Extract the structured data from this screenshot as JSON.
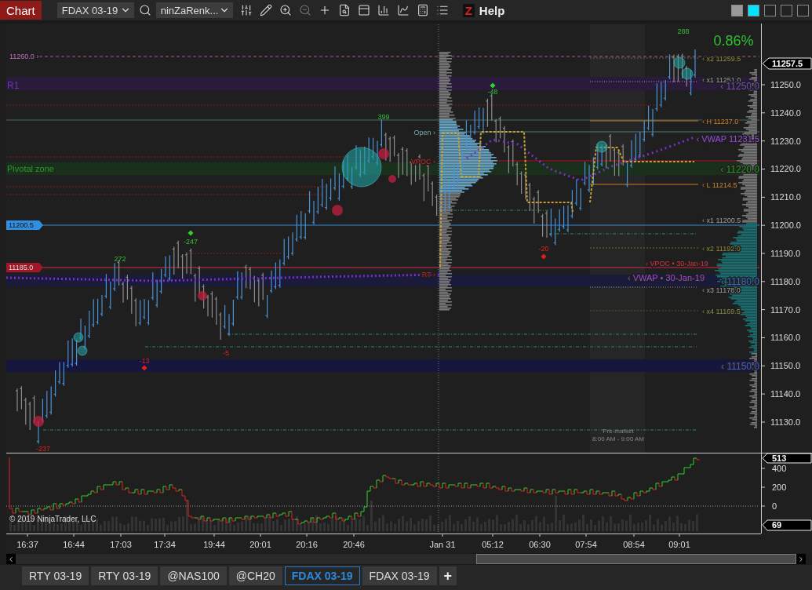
{
  "toolbar": {
    "title": "Chart",
    "instrument": "FDAX 03-19",
    "bar_type": "ninZaRenk...",
    "logo": "Z",
    "help": "Help"
  },
  "price_panel": {
    "change": "0.86%",
    "current_price": "11257.5",
    "y_ticks": [
      "11250.0",
      "11240.0",
      "11230.0",
      "11220.0",
      "11210.0",
      "11200.0",
      "11190.0",
      "11180.0",
      "11170.0",
      "11160.0",
      "11150.0",
      "11140.0",
      "11130.0"
    ],
    "left_tags": [
      {
        "text": "11260.0 ›",
        "kind": "plain"
      },
      {
        "text": "11200.5",
        "kind": "tag"
      },
      {
        "text": "11185.0",
        "kind": "tag"
      }
    ],
    "zone_labels": [
      "R1",
      "Pivotal zone"
    ],
    "level_labels": [
      "‹ x2 11259.5",
      "‹ x1 11251.0",
      "‹ 11250.0",
      "‹ H 11237.0",
      "‹ VWAP 11231.5",
      "‹ 11220.0",
      "‹ L 11214.5",
      "‹ x1 11200.5",
      "‹ x2 11192.0",
      "‹ VPOC • 30-Jan-19",
      "‹ VWAP • 30-Jan-19",
      "‹ 11180.0",
      "‹ x3 11178.0",
      "‹ x4 11169.5",
      "‹ 11150.0"
    ],
    "markers": [
      "Open ›",
      "VPOC ›",
      "RT ›"
    ],
    "annotations": [
      "288",
      "-48",
      "399",
      "-247",
      "272",
      "-20",
      "-5",
      "-13",
      "-237"
    ],
    "session": {
      "title": "Pre-market",
      "hours": "8:00 AM - 9:00 AM"
    }
  },
  "indicator_panel": {
    "y_ticks": [
      "400",
      "200",
      "0"
    ],
    "current_value": "513",
    "low_value": "69",
    "copyright": "© 2019 NinjaTrader, LLC"
  },
  "time_axis": [
    "16:37",
    "16:44",
    "17:03",
    "17:34",
    "19:44",
    "20:01",
    "20:16",
    "20:46",
    "Jan 31",
    "05:12",
    "06:30",
    "07:54",
    "08:54",
    "09:01"
  ],
  "tabs": [
    {
      "label": "RTY 03-19",
      "selected": false
    },
    {
      "label": "RTY 03-19",
      "selected": false
    },
    {
      "label": "@NAS100",
      "selected": false
    },
    {
      "label": "@CH20",
      "selected": false
    },
    {
      "label": "FDAX 03-19",
      "selected": true
    },
    {
      "label": "FDAX 03-19",
      "selected": false
    }
  ],
  "add_tab": "+"
}
